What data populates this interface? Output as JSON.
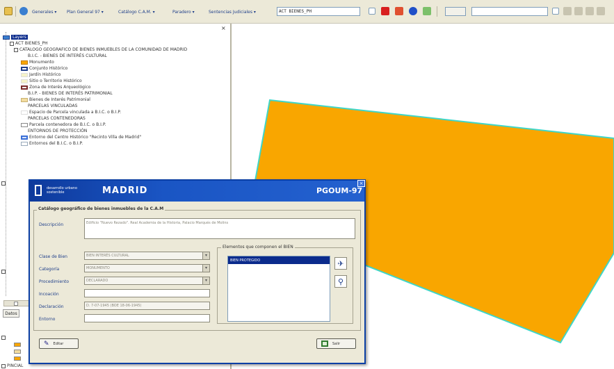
{
  "toolbar": {
    "menus": [
      "Generales ▾",
      "Plan General 97 ▾",
      "Catálogo C.A.M. ▾",
      "Paradero ▾",
      "Sentencias Judiciales ▾"
    ],
    "layer_combo_value": "ACT BIENES_PH"
  },
  "layers_panel": {
    "root_label": "Layers",
    "tree": [
      "ACT BIENES_PH",
      "CATÁLOGO GEOGRÁFICO DE BIENES INMUEBLES DE LA COMUNIDAD DE MADRID",
      "B.I.C. - BIENES DE INTERÉS CULTURAL",
      "Monumento",
      "Conjunto Histórico",
      "Jardín Histórico",
      "Sitio o Territorio Histórico",
      "Zona de Interés Arqueológico",
      "B.I.P. - BIENES DE INTERÉS PATRIMONIAL",
      "Bienes de Interés Patrimonial",
      "PARCELAS VINCULADAS",
      "Espacio de Parcela vinculada a B.I.C. o B.I.P.",
      "PARCELAS CONTENEDORAS",
      "Parcela contenedora de B.I.C. o B.I.P.",
      "ENTORNOS DE PROTECCIÓN",
      "Entorno del Centro Histórico \"Recinto Villa de Madrid\"",
      "Entornos del B.I.C. o B.I.P."
    ],
    "bottom_item": "PINCIAL",
    "tab_label": "Datos"
  },
  "map": {
    "parcel_fill": "#f9a600",
    "parcel_stroke": "#3fd6c8"
  },
  "dialog": {
    "org_text": "desarrollo urbano sostenible",
    "title_left": "MADRID",
    "title_right": "PGOUM-97",
    "group_title": "Catálogo geográfico de bienes inmuebles de la C.A.M",
    "descripcion_label": "Descripción",
    "descripcion_value": "Edificio \"Nuevo Rezado\". Real Academia de la Historia, Palacio Marqués de Molins",
    "clase_label": "Clase de Bien",
    "clase_value": "BIEN INTERÉS CULTURAL",
    "categoria_label": "Categoría",
    "categoria_value": "MONUMENTO",
    "procedimiento_label": "Procedimiento",
    "procedimiento_value": "DECLARADO",
    "incoacion_label": "Incoación",
    "incoacion_value": "",
    "declaracion_label": "Declaración",
    "declaracion_value": "D. 7-07-1945 (BOE 18-06-1945)",
    "entorno_label": "Entorno",
    "entorno_value": "",
    "elements_title": "Elementos que componen el BIEN",
    "elements": [
      "BIEN PROTEGIDO"
    ],
    "edit_label": "Editar",
    "exit_label": "Salir"
  }
}
